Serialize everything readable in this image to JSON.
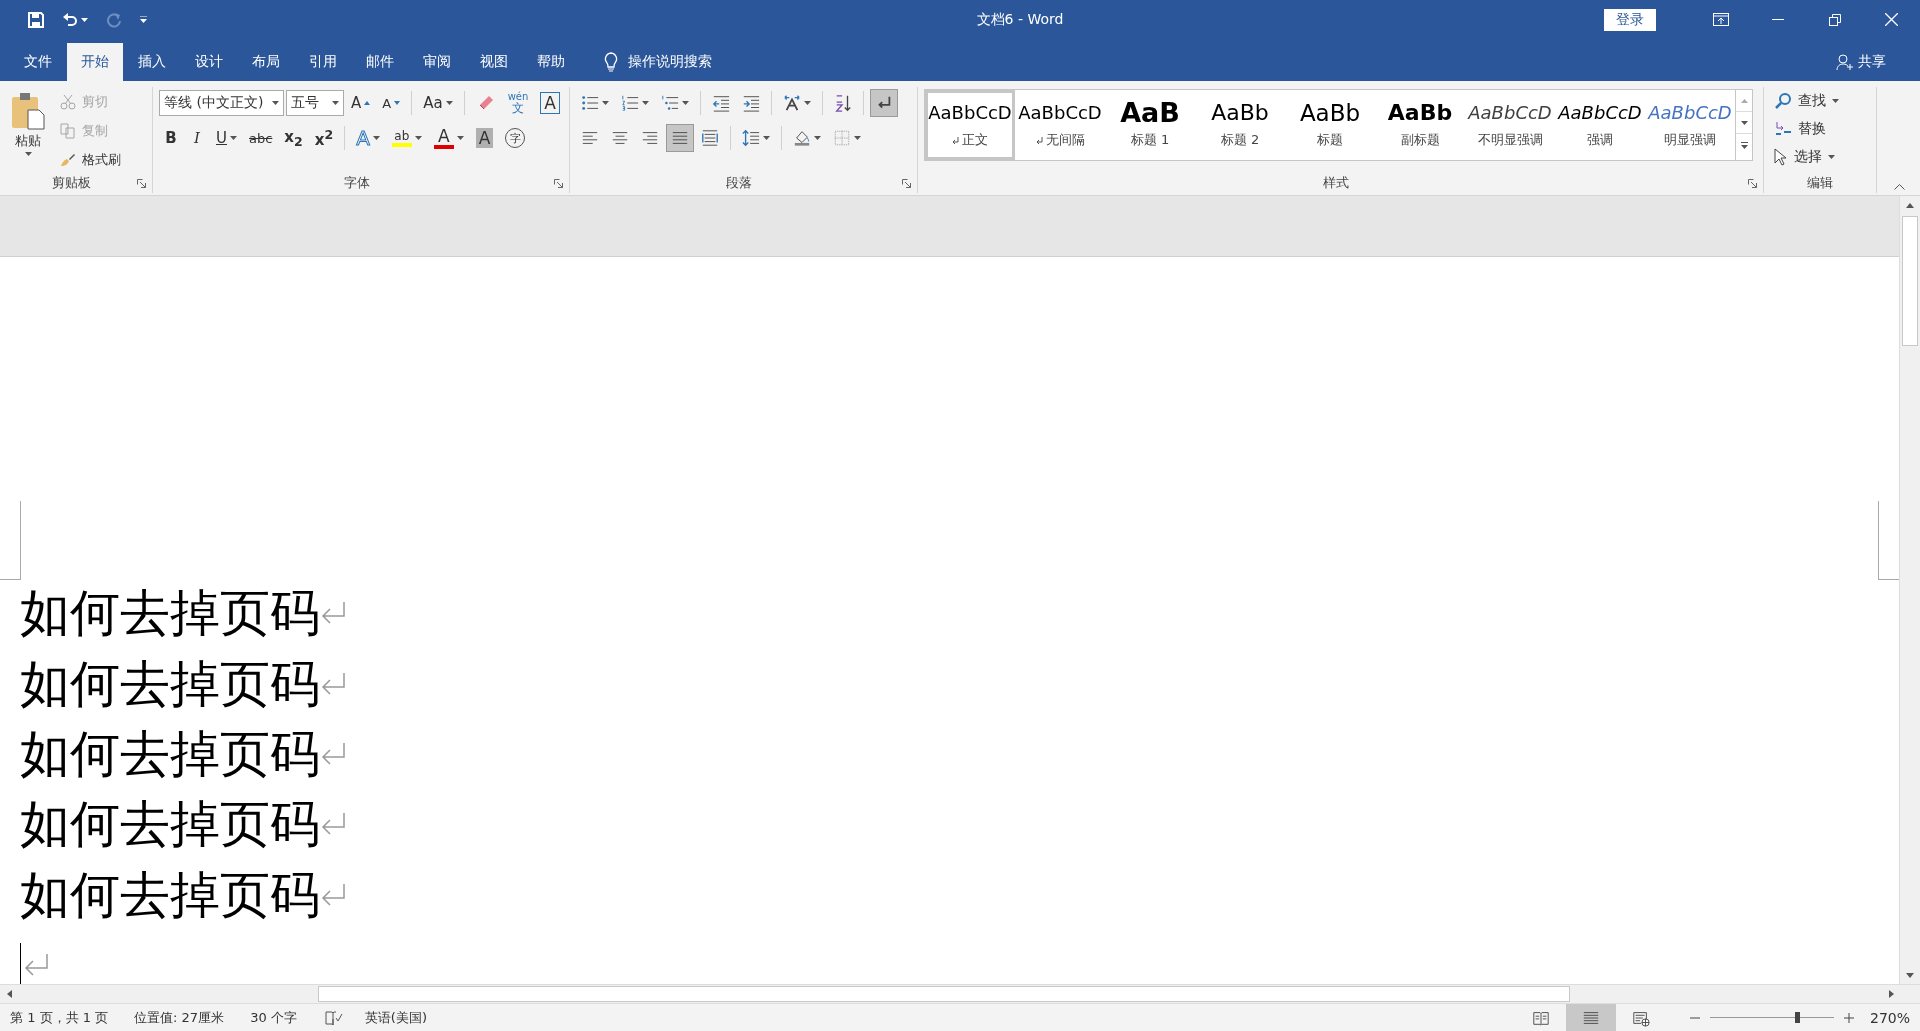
{
  "title_bar": {
    "title": "文档6  -  Word",
    "sign_in": "登录",
    "redo_disabled": true
  },
  "tabs": [
    {
      "label": "文件",
      "selected": false
    },
    {
      "label": "开始",
      "selected": true
    },
    {
      "label": "插入",
      "selected": false
    },
    {
      "label": "设计",
      "selected": false
    },
    {
      "label": "布局",
      "selected": false
    },
    {
      "label": "引用",
      "selected": false
    },
    {
      "label": "邮件",
      "selected": false
    },
    {
      "label": "审阅",
      "selected": false
    },
    {
      "label": "视图",
      "selected": false
    },
    {
      "label": "帮助",
      "selected": false
    }
  ],
  "tell_me": "操作说明搜索",
  "share": "共享",
  "clipboard": {
    "label": "剪贴板",
    "paste": "粘贴",
    "items": [
      {
        "kind": "cut",
        "label": "剪切",
        "disabled": true
      },
      {
        "kind": "copy",
        "label": "复制",
        "disabled": true
      },
      {
        "kind": "painter",
        "label": "格式刷",
        "disabled": false
      }
    ]
  },
  "font": {
    "label": "字体",
    "font_name": "等线 (中文正文)",
    "font_size": "五号",
    "row1": [
      {
        "kind": "grow",
        "text": "A",
        "dropdown": false
      },
      {
        "kind": "shrink",
        "text": "A",
        "dropdown": false
      },
      {
        "kind": "case",
        "text": "Aa",
        "dropdown": true
      },
      {
        "kind": "clear",
        "dropdown": false
      },
      {
        "kind": "phonetic",
        "ruby": "wén",
        "text": "文",
        "dropdown": false
      },
      {
        "kind": "border",
        "text": "A",
        "dropdown": false
      }
    ],
    "row2": [
      {
        "kind": "bold",
        "text": "B",
        "dropdown": false
      },
      {
        "kind": "italic",
        "text": "I",
        "dropdown": false
      },
      {
        "kind": "underline",
        "text": "U",
        "dropdown": true
      },
      {
        "kind": "strike",
        "text": "abc",
        "dropdown": false
      },
      {
        "kind": "sub",
        "text": "x$_{2}$",
        "dropdown": false
      },
      {
        "kind": "sup",
        "text": "x$^{2}$",
        "dropdown": false
      },
      {
        "kind": "effects",
        "text": "A",
        "dropdown": true
      },
      {
        "kind": "highlight",
        "text": "ab",
        "dropdown": true
      },
      {
        "kind": "color",
        "text": "A",
        "dropdown": true
      },
      {
        "kind": "shading",
        "text": "A",
        "dropdown": false
      },
      {
        "kind": "enclose",
        "text": "字",
        "dropdown": false
      }
    ]
  },
  "paragraph": {
    "label": "段落",
    "row1": [
      {
        "kind": "bullets",
        "dropdown": true
      },
      {
        "kind": "numbering",
        "dropdown": true
      },
      {
        "kind": "multilevel",
        "dropdown": true
      },
      {
        "kind": "outdent",
        "dropdown": false
      },
      {
        "kind": "indent",
        "dropdown": false
      },
      {
        "kind": "asian",
        "dropdown": true
      },
      {
        "kind": "sort",
        "dropdown": false
      },
      {
        "kind": "marks",
        "dropdown": false,
        "on": true
      }
    ],
    "row2": [
      {
        "kind": "left",
        "dropdown": false,
        "selected": false
      },
      {
        "kind": "center",
        "dropdown": false,
        "selected": false
      },
      {
        "kind": "right",
        "dropdown": false,
        "selected": false
      },
      {
        "kind": "justify",
        "dropdown": false,
        "selected": true
      },
      {
        "kind": "distributed",
        "dropdown": false,
        "selected": false
      },
      {
        "kind": "spacing",
        "dropdown": true
      },
      {
        "kind": "fill",
        "dropdown": true
      },
      {
        "kind": "borders",
        "dropdown": true
      }
    ]
  },
  "styles": {
    "label": "样式",
    "items": [
      {
        "kind": "normal",
        "preview": "AaBbCcD",
        "name": "正文",
        "para_mark": true,
        "selected": true
      },
      {
        "kind": "normal",
        "preview": "AaBbCcD",
        "name": "无间隔",
        "para_mark": true,
        "selected": false
      },
      {
        "kind": "heading1",
        "preview": "AaB",
        "name": "标题 1",
        "para_mark": false,
        "selected": false
      },
      {
        "kind": "heading2",
        "preview": "AaBb",
        "name": "标题 2",
        "para_mark": false,
        "selected": false
      },
      {
        "kind": "title",
        "preview": "AaBb",
        "name": "标题",
        "para_mark": false,
        "selected": false
      },
      {
        "kind": "subtitle",
        "preview": "AaBb",
        "name": "副标题",
        "para_mark": false,
        "selected": false
      },
      {
        "kind": "subtle",
        "preview": "AaBbCcD",
        "name": "不明显强调",
        "para_mark": false,
        "selected": false
      },
      {
        "kind": "emphasis",
        "preview": "AaBbCcD",
        "name": "强调",
        "para_mark": false,
        "selected": false
      },
      {
        "kind": "intense",
        "preview": "AaBbCcD",
        "name": "明显强调",
        "para_mark": false,
        "selected": false
      }
    ]
  },
  "editing": {
    "label": "编辑",
    "items": [
      {
        "kind": "find",
        "label": "查找",
        "dropdown": true
      },
      {
        "kind": "replace",
        "label": "替换",
        "dropdown": false
      },
      {
        "kind": "select",
        "label": "选择",
        "dropdown": true
      }
    ]
  },
  "document": {
    "paragraphs": [
      {
        "text": "如何去掉页码"
      },
      {
        "text": "如何去掉页码"
      },
      {
        "text": "如何去掉页码"
      },
      {
        "text": "如何去掉页码"
      },
      {
        "text": "如何去掉页码"
      },
      {
        "cursor": true
      }
    ]
  },
  "status_bar": {
    "items": [
      "第 1 页，共 1 页",
      "位置值: 27厘米",
      "30 个字"
    ],
    "language": "英语(美国)",
    "views": [
      {
        "kind": "read",
        "selected": false
      },
      {
        "kind": "print",
        "selected": true
      },
      {
        "kind": "web",
        "selected": false
      }
    ],
    "zoom": {
      "level": 0.7,
      "reading": "270%"
    }
  }
}
